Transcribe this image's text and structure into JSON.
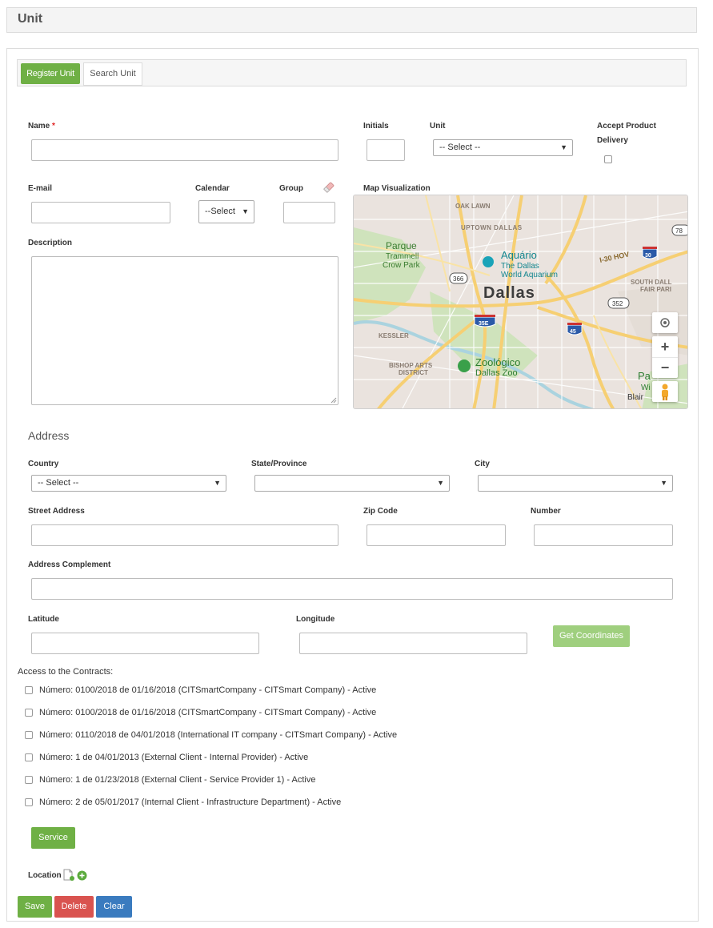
{
  "header": {
    "title": "Unit"
  },
  "tabs": [
    {
      "label": "Register Unit",
      "active": true
    },
    {
      "label": "Search Unit",
      "active": false
    }
  ],
  "form": {
    "name_label": "Name",
    "name_required": "*",
    "name_value": "",
    "initials_label": "Initials",
    "unit_label": "Unit",
    "unit_select": "-- Select --",
    "accept_label_1": "Accept Product",
    "accept_label_2": "Delivery",
    "accept_checked": false,
    "email_label": "E-mail",
    "calendar_label": "Calendar",
    "calendar_select": "--Select",
    "group_label": "Group",
    "description_label": "Description",
    "map_label": "Map Visualization"
  },
  "map": {
    "labels": {
      "oak_lawn": "OAK LAWN",
      "uptown": "UPTOWN DALLAS",
      "parque_1": "Parque",
      "parque_2": "Trammell",
      "parque_3": "Crow Park",
      "aquario_1": "Aquário",
      "aquario_2": "The Dallas",
      "aquario_3": "World Aquarium",
      "hov": "I-30 HOV",
      "south_dallas_1": "SOUTH DALL",
      "south_dallas_2": "FAIR PARI",
      "city": "Dallas",
      "kessler": "KESSLER",
      "bishop_1": "BISHOP ARTS",
      "bishop_2": "DISTRICT",
      "zoo_1": "Zoológico",
      "zoo_2": "Dallas Zoo",
      "pa": "Pa",
      "wi": "Wi",
      "blair": "Blair",
      "shield_366": "366",
      "shield_352": "352",
      "shield_78": "78",
      "shield_30": "30",
      "shield_35e": "35E",
      "shield_45": "45"
    },
    "controls": {
      "zoom_in": "+",
      "zoom_out": "−"
    }
  },
  "address": {
    "title": "Address",
    "country_label": "Country",
    "country_select": "-- Select --",
    "state_label": "State/Province",
    "state_select": "",
    "city_label": "City",
    "city_select": "",
    "street_label": "Street Address",
    "zip_label": "Zip Code",
    "number_label": "Number",
    "complement_label": "Address Complement",
    "latitude_label": "Latitude",
    "longitude_label": "Longitude",
    "get_coordinates": "Get Coordinates"
  },
  "contracts": {
    "title": "Access to the Contracts:",
    "items": [
      {
        "text": "Número: 0100/2018 de 01/16/2018 (CITSmartCompany - CITSmart Company) - Active",
        "checked": false
      },
      {
        "text": "Número: 0100/2018 de 01/16/2018 (CITSmartCompany - CITSmart Company) - Active",
        "checked": false
      },
      {
        "text": "Número: 0110/2018 de 04/01/2018 (International IT company - CITSmart Company) - Active",
        "checked": false
      },
      {
        "text": "Número: 1 de 04/01/2013 (External Client - Internal Provider) - Active",
        "checked": false
      },
      {
        "text": "Número: 1 de 01/23/2018 (External Client - Service Provider 1) - Active",
        "checked": false
      },
      {
        "text": "Número: 2 de 05/01/2017 (Internal Client - Infrastructure Department) - Active",
        "checked": false
      }
    ]
  },
  "service_button": "Service",
  "location_label": "Location",
  "actions": {
    "save": "Save",
    "delete": "Delete",
    "clear": "Clear"
  },
  "colors": {
    "green": "#6fb045",
    "green_light": "#9fcf7e",
    "red": "#d9534f",
    "blue": "#3a7bbf"
  }
}
